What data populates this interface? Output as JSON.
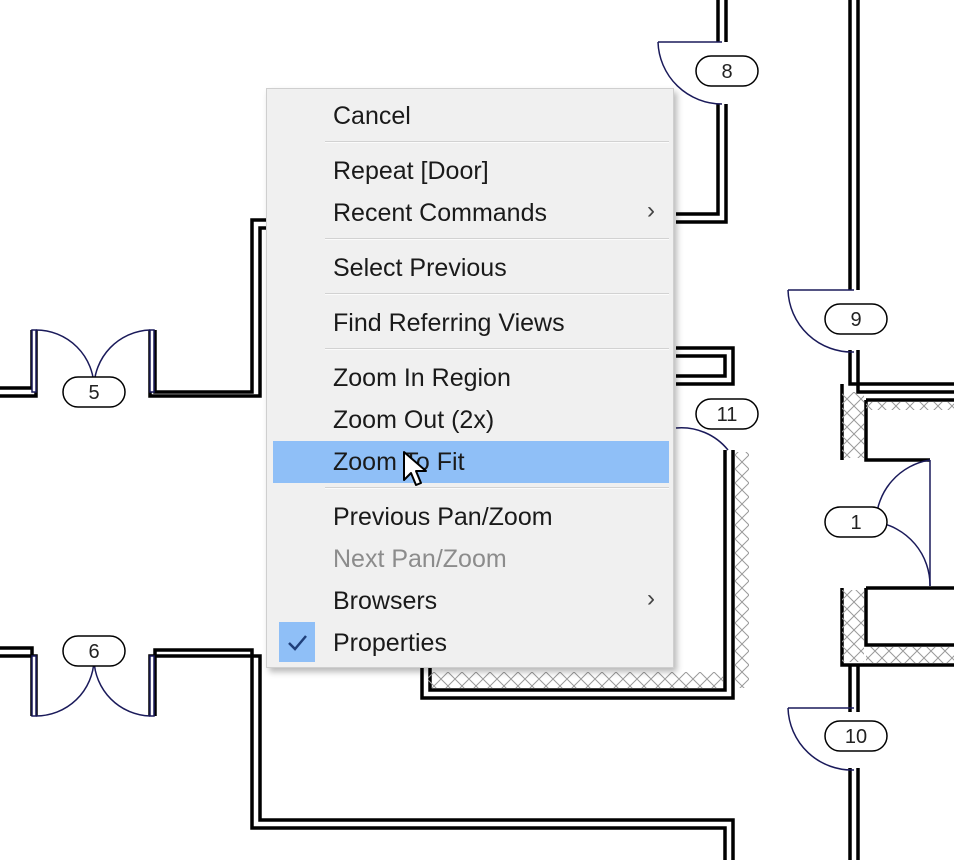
{
  "floor_plan": {
    "door_tags": [
      "5",
      "6",
      "8",
      "9",
      "10",
      "11",
      "1"
    ]
  },
  "context_menu": {
    "items": [
      {
        "label": "Cancel",
        "enabled": true
      },
      {
        "label": "Repeat [Door]",
        "enabled": true
      },
      {
        "label": "Recent Commands",
        "enabled": true,
        "submenu": true
      },
      {
        "label": "Select Previous",
        "enabled": true
      },
      {
        "label": "Find Referring Views",
        "enabled": true
      },
      {
        "label": "Zoom In Region",
        "enabled": true
      },
      {
        "label": "Zoom Out (2x)",
        "enabled": true
      },
      {
        "label": "Zoom To Fit",
        "enabled": true,
        "highlighted": true
      },
      {
        "label": "Previous Pan/Zoom",
        "enabled": true
      },
      {
        "label": "Next Pan/Zoom",
        "enabled": false
      },
      {
        "label": "Browsers",
        "enabled": true,
        "submenu": true
      },
      {
        "label": "Properties",
        "enabled": true,
        "checked": true
      }
    ],
    "submenu_glyph": "›",
    "check_glyph": "✓",
    "highlight_color": "#8fbff7"
  }
}
